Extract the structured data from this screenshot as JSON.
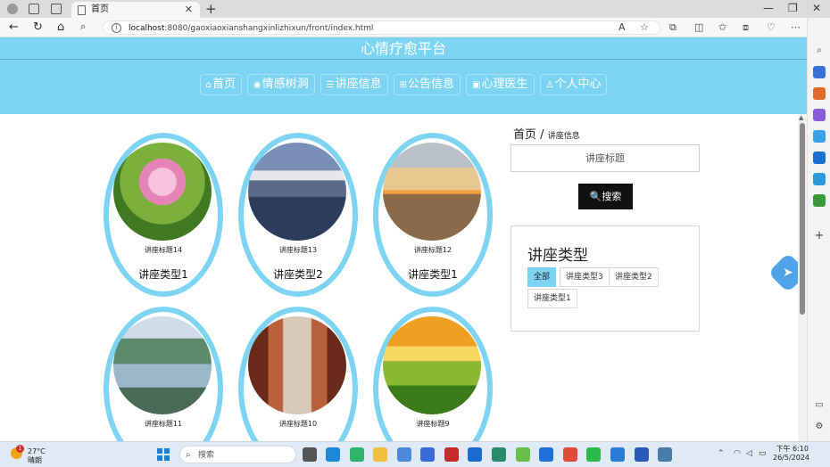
{
  "browser": {
    "tab_title": "首页",
    "new_tab": "+",
    "url_host": "localhost",
    "url_rest": ":8080/gaoxiaoxianshangxinlizhixun/front/index.html",
    "minimize": "—",
    "maximize": "❐",
    "close": "✕"
  },
  "site": {
    "title": "心情疗愈平台",
    "nav": [
      {
        "icon": "⌂",
        "label": "首页"
      },
      {
        "icon": "◉",
        "label": "情感树洞"
      },
      {
        "icon": "☰",
        "label": "讲座信息"
      },
      {
        "icon": "⊞",
        "label": "公告信息"
      },
      {
        "icon": "▣",
        "label": "心理医生"
      },
      {
        "icon": "♙",
        "label": "个人中心"
      }
    ]
  },
  "breadcrumb": {
    "home": "首页",
    "separator": "/",
    "current": "讲座信息"
  },
  "search": {
    "placeholder": "讲座标题",
    "button": "🔍搜索"
  },
  "type_filter": {
    "title": "讲座类型",
    "chips": [
      "全部",
      "讲座类型3",
      "讲座类型2",
      "讲座类型1"
    ],
    "active": "全部"
  },
  "cards": [
    {
      "title": "讲座标题14",
      "type": "讲座类型1",
      "image": "pink lotus flower"
    },
    {
      "title": "讲座标题13",
      "type": "讲座类型2",
      "image": "city skyline with mountain"
    },
    {
      "title": "讲座标题12",
      "type": "讲座类型1",
      "image": "desert sunset"
    },
    {
      "title": "讲座标题11",
      "type": "",
      "image": "karst mountains reflected in river"
    },
    {
      "title": "讲座标题10",
      "type": "",
      "image": "red wooden corridor"
    },
    {
      "title": "讲座标题9",
      "type": "",
      "image": "daisy meadow at sunrise"
    }
  ],
  "taskbar": {
    "temperature": "27°C",
    "condition": "晴朗",
    "weather_badge": "1",
    "search_placeholder": "搜索",
    "time": "下午 6:10",
    "date": "26/5/2024"
  },
  "colors": {
    "accent": "#7dd3f2",
    "button": "#111111"
  }
}
